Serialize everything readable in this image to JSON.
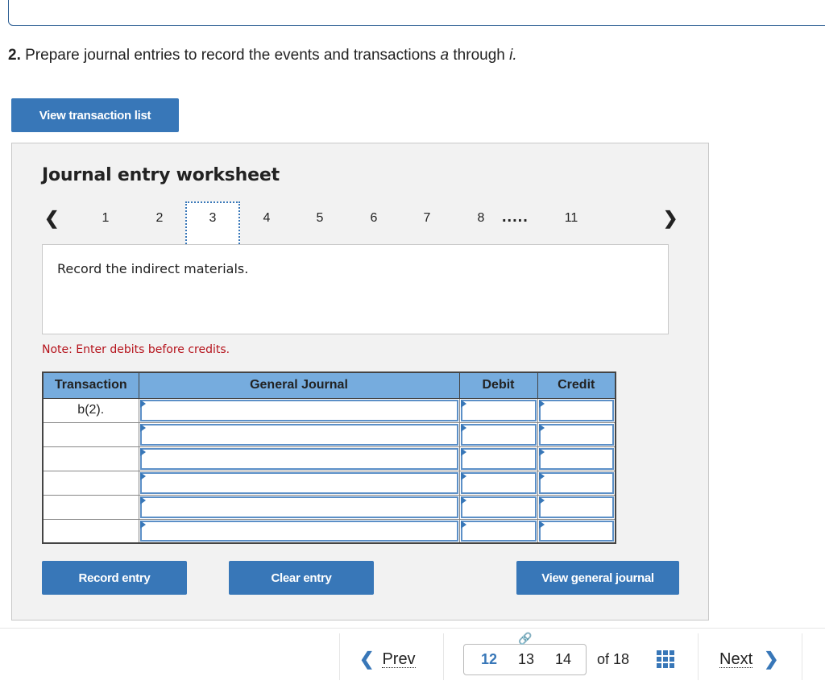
{
  "question": {
    "number": "2.",
    "text_before": " Prepare journal entries to record the events and transactions ",
    "italic_a": "a",
    "text_mid": " through ",
    "italic_i": "i."
  },
  "buttons": {
    "view_transaction_list": "View transaction list",
    "record_entry": "Record entry",
    "clear_entry": "Clear entry",
    "view_general_journal": "View general journal"
  },
  "worksheet": {
    "title": "Journal entry worksheet",
    "prev_icon": "chevron-left-icon",
    "next_icon": "chevron-right-icon",
    "pages": [
      "1",
      "2",
      "3",
      "4",
      "5",
      "6",
      "7",
      "8"
    ],
    "ellipsis": ".....",
    "last_page": "11",
    "active_page": "3",
    "description": "Record the indirect materials.",
    "note": "Note: Enter debits before credits."
  },
  "journal_table": {
    "headers": [
      "Transaction",
      "General Journal",
      "Debit",
      "Credit"
    ],
    "rows": [
      {
        "transaction": "b(2).",
        "account": "",
        "debit": "",
        "credit": ""
      },
      {
        "transaction": "",
        "account": "",
        "debit": "",
        "credit": ""
      },
      {
        "transaction": "",
        "account": "",
        "debit": "",
        "credit": ""
      },
      {
        "transaction": "",
        "account": "",
        "debit": "",
        "credit": ""
      },
      {
        "transaction": "",
        "account": "",
        "debit": "",
        "credit": ""
      },
      {
        "transaction": "",
        "account": "",
        "debit": "",
        "credit": ""
      }
    ]
  },
  "footer": {
    "prev_label": "Prev",
    "next_label": "Next",
    "pages": [
      "12",
      "13",
      "14"
    ],
    "current_page": "12",
    "of_label": "of 18",
    "link_icon": "link-icon",
    "grid_icon": "grid-icon"
  },
  "colors": {
    "accent": "#3877b8",
    "table_header": "#76acde",
    "note": "#b5121b",
    "panel_bg": "#f2f2f2"
  }
}
